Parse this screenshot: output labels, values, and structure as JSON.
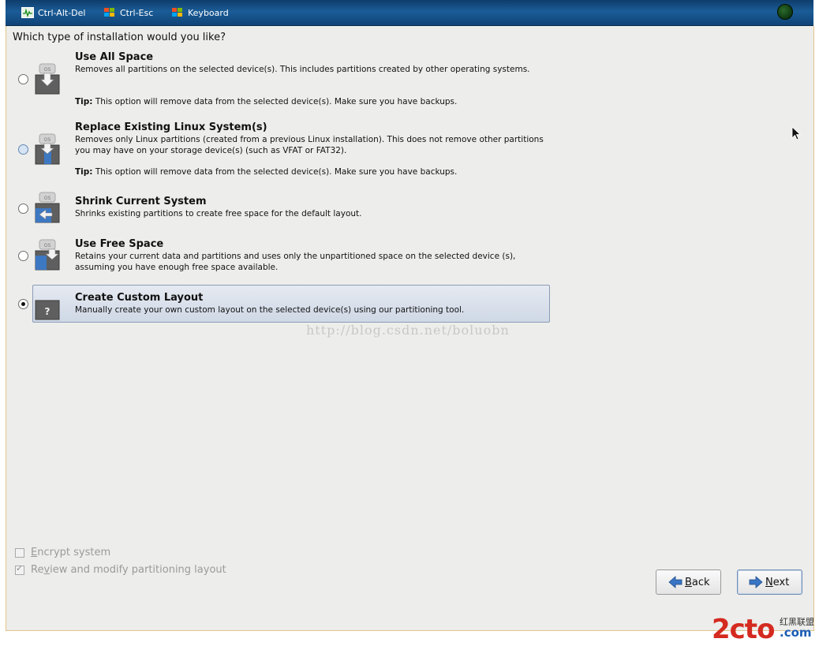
{
  "toolbar": {
    "ctrl_alt_del": "Ctrl-Alt-Del",
    "ctrl_esc": "Ctrl-Esc",
    "keyboard": "Keyboard"
  },
  "question": "Which type of installation would you like?",
  "options": [
    {
      "title": "Use All Space",
      "desc": "Removes all partitions on the selected device(s).  This includes partitions created by other operating systems.",
      "tip_label": "Tip:",
      "tip": " This option will remove data from the selected device(s).  Make sure you have backups.",
      "icon": "os-disk-down-arrow-icon",
      "selected": false
    },
    {
      "title": "Replace Existing Linux System(s)",
      "desc": "Removes only Linux partitions (created from a previous Linux installation).  This does not remove other partitions you may have on your storage device(s) (such as VFAT or FAT32).",
      "tip_label": "Tip:",
      "tip": " This option will remove data from the selected device(s).  Make sure you have backups.",
      "icon": "os-disk-replace-icon",
      "selected": false
    },
    {
      "title": "Shrink Current System",
      "desc": "Shrinks existing partitions to create free space for the default layout.",
      "icon": "os-disk-shrink-icon",
      "selected": false
    },
    {
      "title": "Use Free Space",
      "desc": "Retains your current data and partitions and uses only the unpartitioned space on the selected device (s), assuming you have enough free space available.",
      "icon": "os-disk-free-space-icon",
      "selected": false
    },
    {
      "title": "Create Custom Layout",
      "desc": "Manually create your own custom layout on the selected device(s) using our partitioning tool.",
      "icon": "custom-layout-question-icon",
      "selected": true
    }
  ],
  "watermark": "http://blog.csdn.net/boluobn",
  "checkboxes": {
    "encrypt": {
      "label_prefix": "",
      "label_u": "E",
      "label_rest": "ncrypt system",
      "checked": false
    },
    "review": {
      "label_prefix": "Re",
      "label_u": "v",
      "label_rest": "iew and modify partitioning layout",
      "checked": true
    }
  },
  "buttons": {
    "back_u": "B",
    "back_rest": "ack",
    "next_u": "N",
    "next_rest": "ext"
  },
  "brand": {
    "main": "2cto",
    "suffix": ".com",
    "cn": "红黑联盟"
  },
  "colors": {
    "toolbar": "#1b5c97",
    "panel": "#ededeb",
    "selection": "#cfd8e6",
    "brand_red": "#d42a1f",
    "brand_blue": "#1d5db4"
  }
}
